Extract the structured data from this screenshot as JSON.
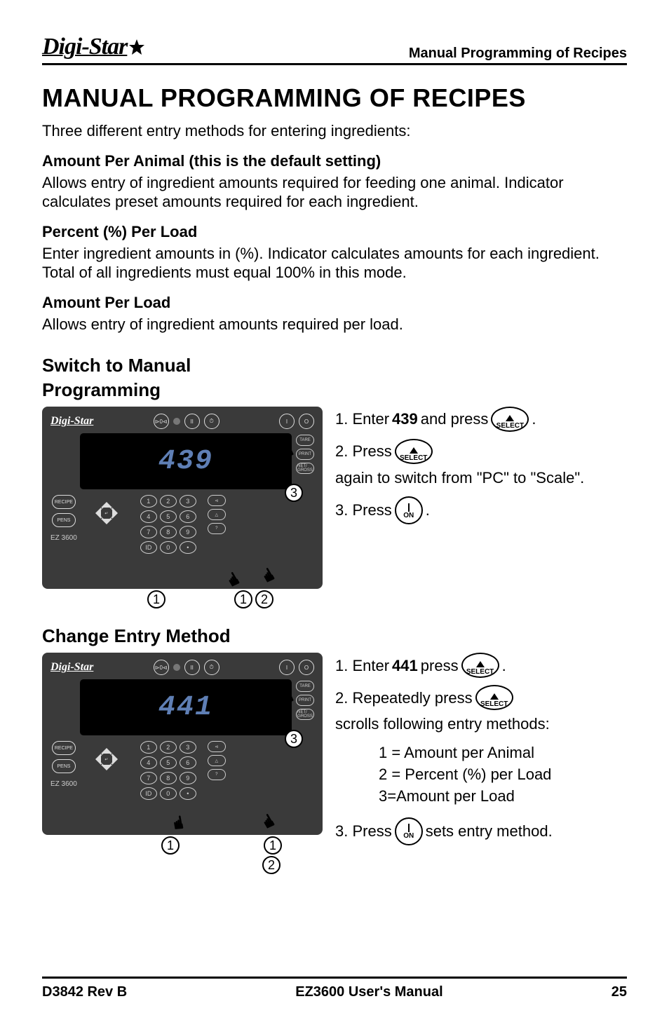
{
  "header": {
    "logo": "Digi-Star",
    "title": "Manual Programming of Recipes"
  },
  "main_heading": "MANUAL PROGRAMMING OF RECIPES",
  "intro": "Three different entry methods for entering ingredients:",
  "methods": {
    "m1_title": "Amount Per Animal (this is the default setting)",
    "m1_body": "Allows entry of ingredient amounts required for feeding one animal. Indicator calculates preset amounts required for each ingredient.",
    "m2_title": "Percent (%) Per Load",
    "m2_body": "Enter ingredient amounts in (%). Indicator calculates amounts for each ingredient. Total of all ingredients must equal 100% in this mode.",
    "m3_title": "Amount Per Load",
    "m3_body": "Allows entry of ingredient amounts required per load."
  },
  "section1": {
    "heading_l1": "Switch to Manual",
    "heading_l2": "Programming",
    "display": "439",
    "model": "EZ 3600",
    "callouts": {
      "a": "1",
      "b": "1",
      "c": "2",
      "side": "3"
    },
    "step1_a": "1. Enter ",
    "step1_b": "439",
    "step1_c": " and press ",
    "step2_a": "2. Press ",
    "step2_b": " again to switch from \"PC\" to \"Scale\".",
    "step3_a": "3. Press ",
    "btn_select": "SELECT",
    "btn_on": "ON"
  },
  "section2": {
    "heading": "Change Entry Method",
    "display": "441",
    "model": "EZ 3600",
    "callouts": {
      "a": "1",
      "b": "1",
      "c": "2",
      "side": "3"
    },
    "step1_a": "1. Enter ",
    "step1_b": "441",
    "step1_c": " press ",
    "step2_a": "2. Repeatedly press ",
    "step2_b": " scrolls following entry methods:",
    "entry1": "1 = Amount per Animal",
    "entry2": "2 = Percent (%) per Load",
    "entry3": "3=Amount per Load",
    "step3_a": "3. Press ",
    "step3_b": " sets entry method.",
    "btn_select": "SELECT",
    "btn_on": "ON"
  },
  "footer": {
    "left": "D3842 Rev B",
    "center": "EZ3600 User's Manual",
    "right": "25"
  }
}
